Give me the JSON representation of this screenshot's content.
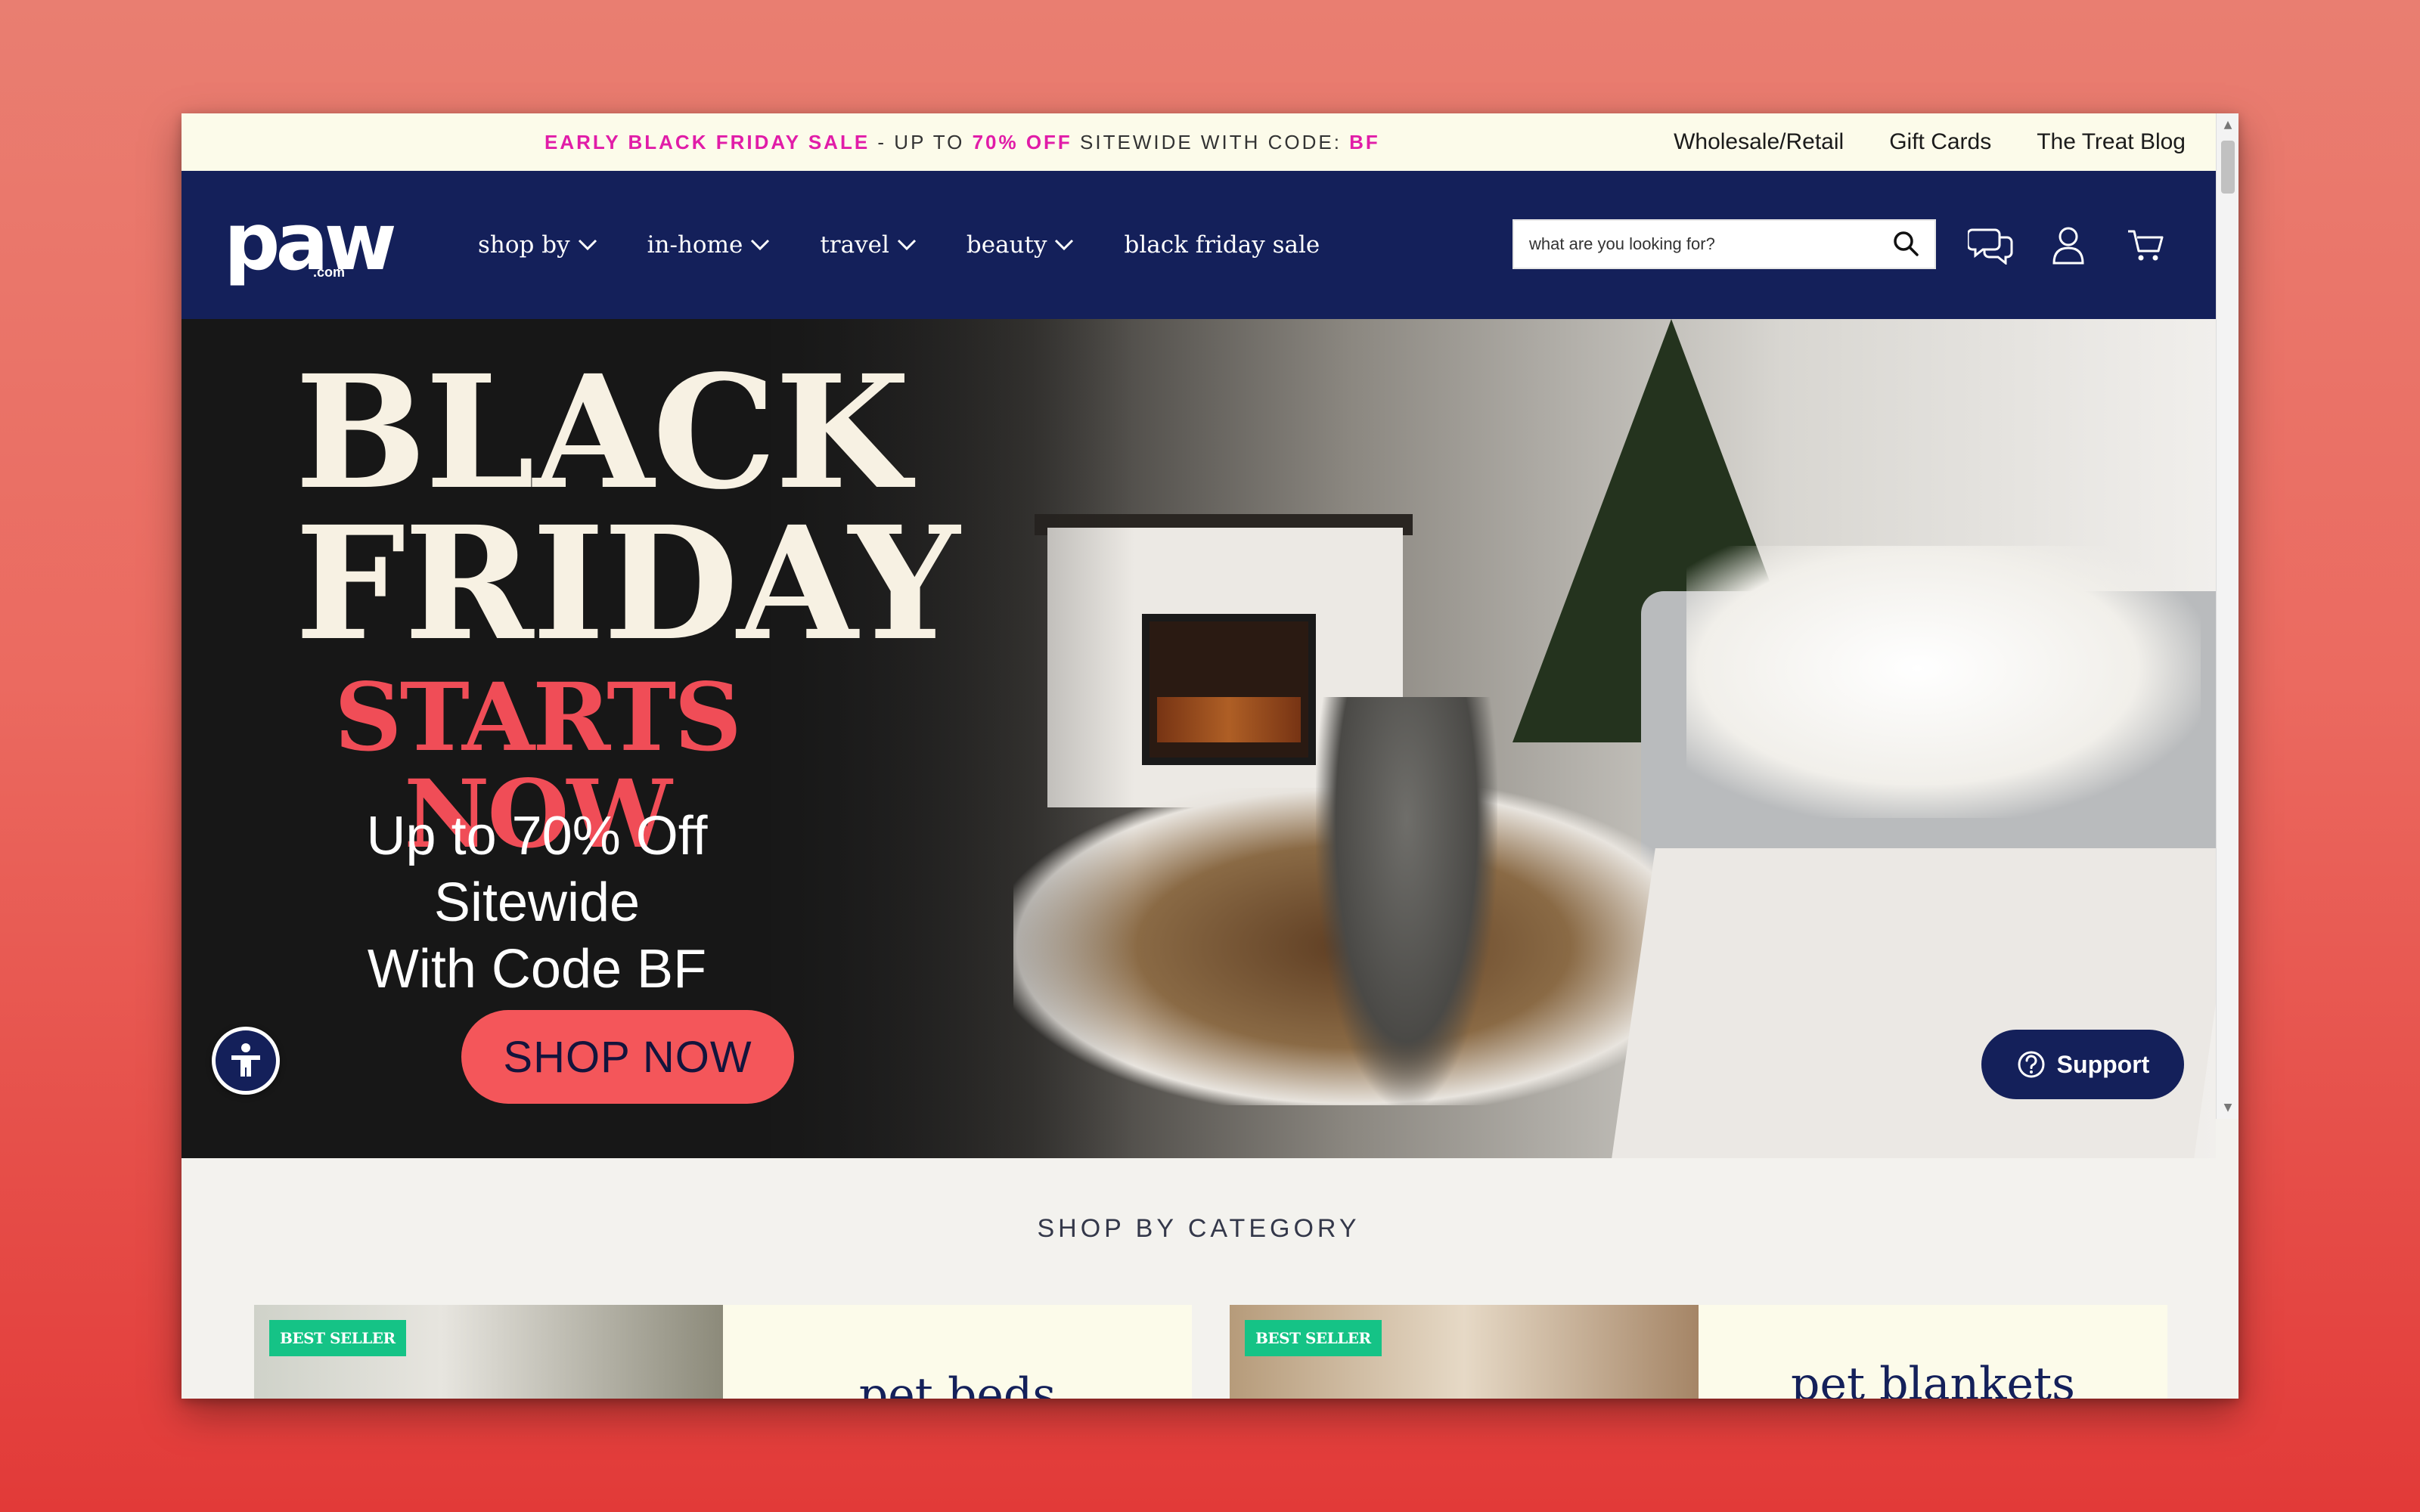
{
  "announcement": {
    "promo_part1": "EARLY BLACK FRIDAY SALE",
    "promo_part2": " - UP TO ",
    "promo_part3": "70% OFF",
    "promo_part4": " SITEWIDE WITH CODE: ",
    "promo_part5": "BF",
    "links": [
      "Wholesale/Retail",
      "Gift Cards",
      "The Treat Blog"
    ]
  },
  "header": {
    "logo_main": "paw",
    "logo_sub": ".com",
    "menu": [
      {
        "label": "shop by",
        "dropdown": true
      },
      {
        "label": "in-home",
        "dropdown": true
      },
      {
        "label": "travel",
        "dropdown": true
      },
      {
        "label": "beauty",
        "dropdown": true
      },
      {
        "label": "black friday sale",
        "dropdown": false
      }
    ],
    "search_placeholder": "what are you looking for?",
    "icons": [
      "chat-icon",
      "account-icon",
      "cart-icon"
    ]
  },
  "hero": {
    "line1": "BLACK",
    "line2": "FRIDAY",
    "line3": "STARTS NOW",
    "subtitle1": "Up to 70% Off Sitewide",
    "subtitle2": "With Code BF",
    "cta": "SHOP NOW",
    "support_label": "Support"
  },
  "category_section": {
    "title": "SHOP BY CATEGORY",
    "cards": [
      {
        "badge": "BEST SELLER",
        "title": "pet beds"
      },
      {
        "badge": "BEST SELLER",
        "title": "pet blankets"
      }
    ]
  },
  "colors": {
    "navy": "#14205a",
    "promo_pink": "#e11ca8",
    "hero_red": "#f04d57",
    "badge_green": "#15c386",
    "cream": "#fcfbea"
  }
}
